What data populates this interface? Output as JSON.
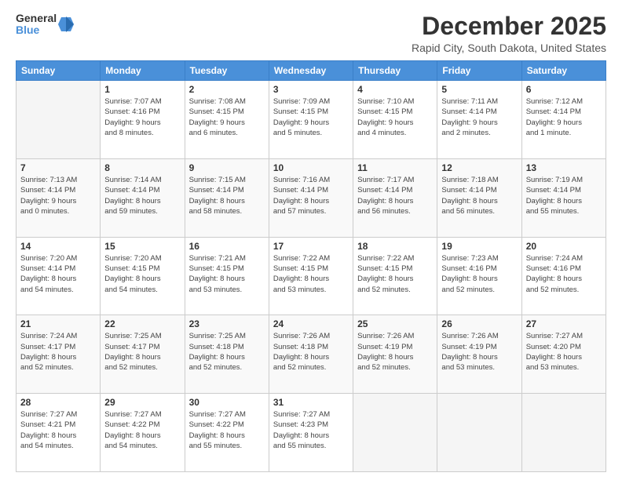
{
  "logo": {
    "general": "General",
    "blue": "Blue"
  },
  "title": "December 2025",
  "location": "Rapid City, South Dakota, United States",
  "headers": [
    "Sunday",
    "Monday",
    "Tuesday",
    "Wednesday",
    "Thursday",
    "Friday",
    "Saturday"
  ],
  "weeks": [
    [
      {
        "day": "",
        "info": ""
      },
      {
        "day": "1",
        "info": "Sunrise: 7:07 AM\nSunset: 4:16 PM\nDaylight: 9 hours\nand 8 minutes."
      },
      {
        "day": "2",
        "info": "Sunrise: 7:08 AM\nSunset: 4:15 PM\nDaylight: 9 hours\nand 6 minutes."
      },
      {
        "day": "3",
        "info": "Sunrise: 7:09 AM\nSunset: 4:15 PM\nDaylight: 9 hours\nand 5 minutes."
      },
      {
        "day": "4",
        "info": "Sunrise: 7:10 AM\nSunset: 4:15 PM\nDaylight: 9 hours\nand 4 minutes."
      },
      {
        "day": "5",
        "info": "Sunrise: 7:11 AM\nSunset: 4:14 PM\nDaylight: 9 hours\nand 2 minutes."
      },
      {
        "day": "6",
        "info": "Sunrise: 7:12 AM\nSunset: 4:14 PM\nDaylight: 9 hours\nand 1 minute."
      }
    ],
    [
      {
        "day": "7",
        "info": "Sunrise: 7:13 AM\nSunset: 4:14 PM\nDaylight: 9 hours\nand 0 minutes."
      },
      {
        "day": "8",
        "info": "Sunrise: 7:14 AM\nSunset: 4:14 PM\nDaylight: 8 hours\nand 59 minutes."
      },
      {
        "day": "9",
        "info": "Sunrise: 7:15 AM\nSunset: 4:14 PM\nDaylight: 8 hours\nand 58 minutes."
      },
      {
        "day": "10",
        "info": "Sunrise: 7:16 AM\nSunset: 4:14 PM\nDaylight: 8 hours\nand 57 minutes."
      },
      {
        "day": "11",
        "info": "Sunrise: 7:17 AM\nSunset: 4:14 PM\nDaylight: 8 hours\nand 56 minutes."
      },
      {
        "day": "12",
        "info": "Sunrise: 7:18 AM\nSunset: 4:14 PM\nDaylight: 8 hours\nand 56 minutes."
      },
      {
        "day": "13",
        "info": "Sunrise: 7:19 AM\nSunset: 4:14 PM\nDaylight: 8 hours\nand 55 minutes."
      }
    ],
    [
      {
        "day": "14",
        "info": "Sunrise: 7:20 AM\nSunset: 4:14 PM\nDaylight: 8 hours\nand 54 minutes."
      },
      {
        "day": "15",
        "info": "Sunrise: 7:20 AM\nSunset: 4:15 PM\nDaylight: 8 hours\nand 54 minutes."
      },
      {
        "day": "16",
        "info": "Sunrise: 7:21 AM\nSunset: 4:15 PM\nDaylight: 8 hours\nand 53 minutes."
      },
      {
        "day": "17",
        "info": "Sunrise: 7:22 AM\nSunset: 4:15 PM\nDaylight: 8 hours\nand 53 minutes."
      },
      {
        "day": "18",
        "info": "Sunrise: 7:22 AM\nSunset: 4:15 PM\nDaylight: 8 hours\nand 52 minutes."
      },
      {
        "day": "19",
        "info": "Sunrise: 7:23 AM\nSunset: 4:16 PM\nDaylight: 8 hours\nand 52 minutes."
      },
      {
        "day": "20",
        "info": "Sunrise: 7:24 AM\nSunset: 4:16 PM\nDaylight: 8 hours\nand 52 minutes."
      }
    ],
    [
      {
        "day": "21",
        "info": "Sunrise: 7:24 AM\nSunset: 4:17 PM\nDaylight: 8 hours\nand 52 minutes."
      },
      {
        "day": "22",
        "info": "Sunrise: 7:25 AM\nSunset: 4:17 PM\nDaylight: 8 hours\nand 52 minutes."
      },
      {
        "day": "23",
        "info": "Sunrise: 7:25 AM\nSunset: 4:18 PM\nDaylight: 8 hours\nand 52 minutes."
      },
      {
        "day": "24",
        "info": "Sunrise: 7:26 AM\nSunset: 4:18 PM\nDaylight: 8 hours\nand 52 minutes."
      },
      {
        "day": "25",
        "info": "Sunrise: 7:26 AM\nSunset: 4:19 PM\nDaylight: 8 hours\nand 52 minutes."
      },
      {
        "day": "26",
        "info": "Sunrise: 7:26 AM\nSunset: 4:19 PM\nDaylight: 8 hours\nand 53 minutes."
      },
      {
        "day": "27",
        "info": "Sunrise: 7:27 AM\nSunset: 4:20 PM\nDaylight: 8 hours\nand 53 minutes."
      }
    ],
    [
      {
        "day": "28",
        "info": "Sunrise: 7:27 AM\nSunset: 4:21 PM\nDaylight: 8 hours\nand 54 minutes."
      },
      {
        "day": "29",
        "info": "Sunrise: 7:27 AM\nSunset: 4:22 PM\nDaylight: 8 hours\nand 54 minutes."
      },
      {
        "day": "30",
        "info": "Sunrise: 7:27 AM\nSunset: 4:22 PM\nDaylight: 8 hours\nand 55 minutes."
      },
      {
        "day": "31",
        "info": "Sunrise: 7:27 AM\nSunset: 4:23 PM\nDaylight: 8 hours\nand 55 minutes."
      },
      {
        "day": "",
        "info": ""
      },
      {
        "day": "",
        "info": ""
      },
      {
        "day": "",
        "info": ""
      }
    ]
  ]
}
